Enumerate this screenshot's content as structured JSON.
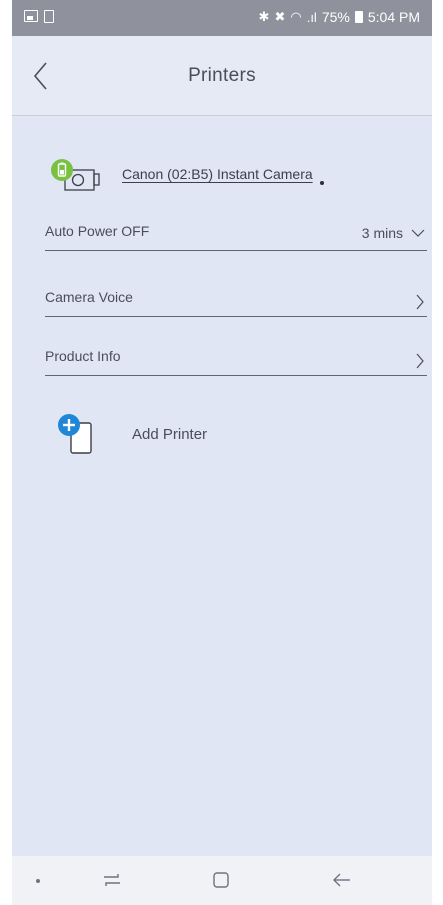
{
  "status_bar": {
    "bluetooth_icon": "bluetooth-icon",
    "mute_icon": "vibrate-mute-icon",
    "wifi_icon": "wifi-icon",
    "signal_icon": "signal-icon",
    "battery_percent": "75%",
    "time": "5:04 PM"
  },
  "header": {
    "title": "Printers",
    "back_icon": "chevron-left-icon"
  },
  "printer": {
    "name": "Canon (02:B5) Instant Camera",
    "icon": "camera-icon",
    "status_color": "#7ac142"
  },
  "settings": [
    {
      "label": "Auto Power OFF",
      "value": "3 mins",
      "control": "chevron-down-icon"
    },
    {
      "label": "Camera Voice",
      "value": "",
      "control": "chevron-right-icon"
    },
    {
      "label": "Product Info",
      "value": "",
      "control": "chevron-right-icon"
    }
  ],
  "add_printer": {
    "label": "Add Printer",
    "icon": "add-printer-icon",
    "accent": "#1f86d8"
  },
  "nav_bar": {
    "items": [
      "dot-icon",
      "recent-apps-icon",
      "home-icon",
      "back-icon"
    ]
  }
}
